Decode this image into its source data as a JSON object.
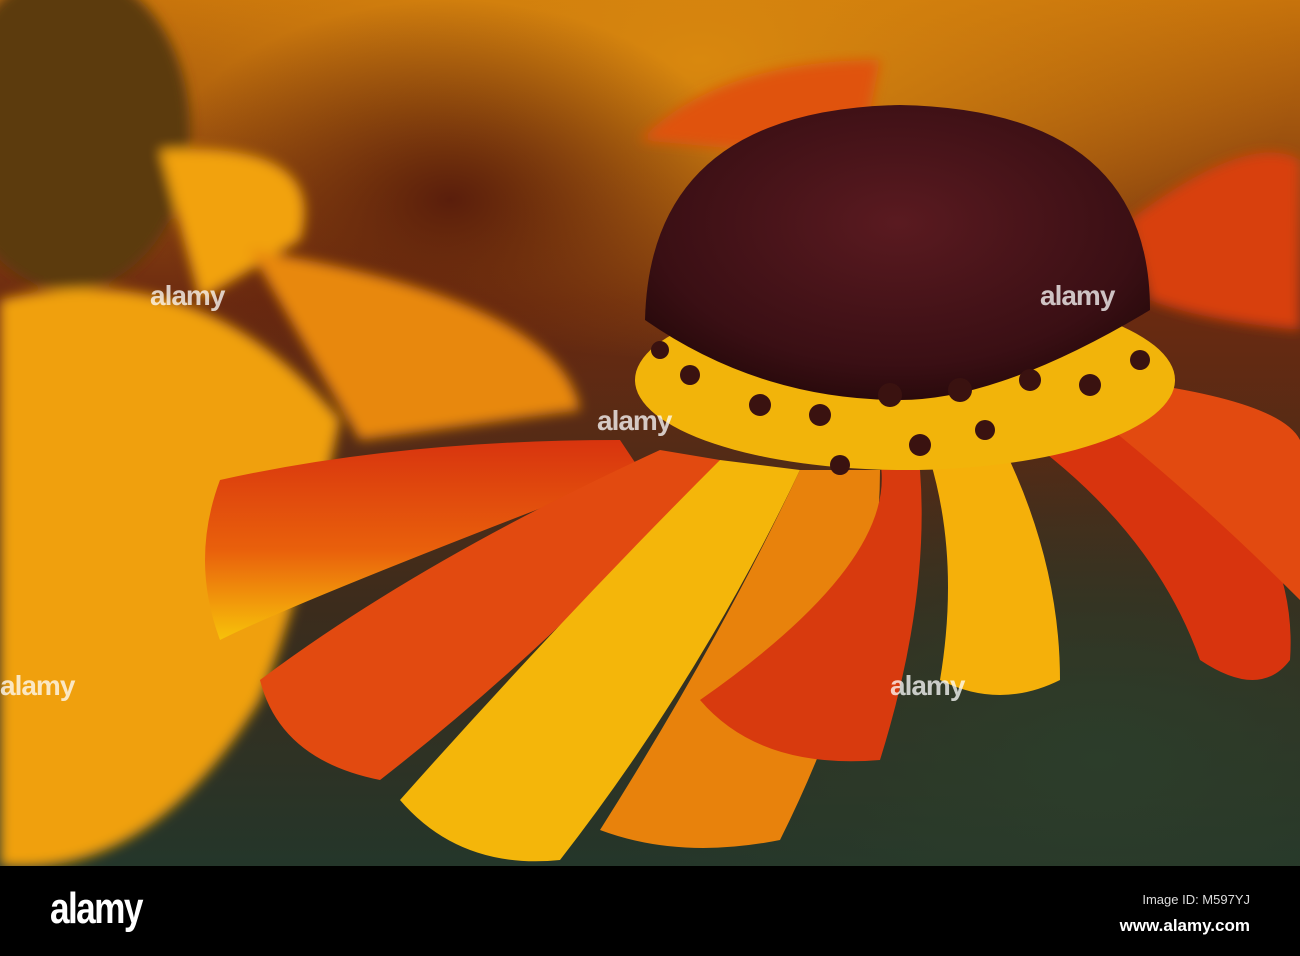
{
  "watermark": {
    "text": "alamy"
  },
  "footer": {
    "logo": "alamy",
    "image_id": "Image ID: M597YJ",
    "website": "www.alamy.com"
  },
  "colors": {
    "petal_red": "#d8340e",
    "petal_yellow": "#f7c20a",
    "disc": "#4a1418",
    "background_green": "#2c3d2a"
  }
}
